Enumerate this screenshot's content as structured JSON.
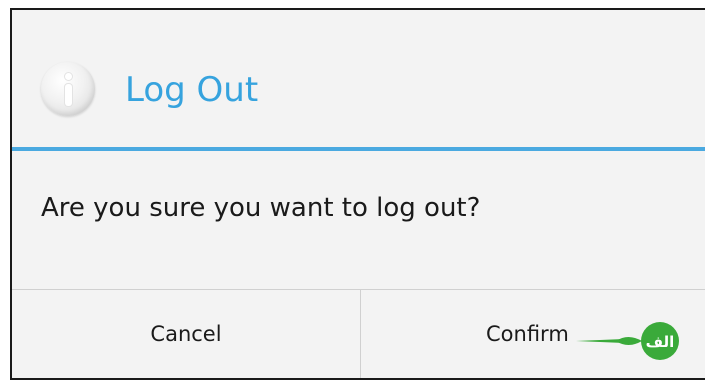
{
  "dialog": {
    "title": "Log Out",
    "title_icon": "info-icon",
    "message": "Are you sure you want to log out?",
    "buttons": {
      "cancel_label": "Cancel",
      "confirm_label": "Confirm"
    },
    "watermark_text": "الف",
    "colors": {
      "accent": "#36a3de",
      "background": "#f3f3f3",
      "text": "#1a1a1a",
      "watermark": "#3aaa3a"
    }
  }
}
